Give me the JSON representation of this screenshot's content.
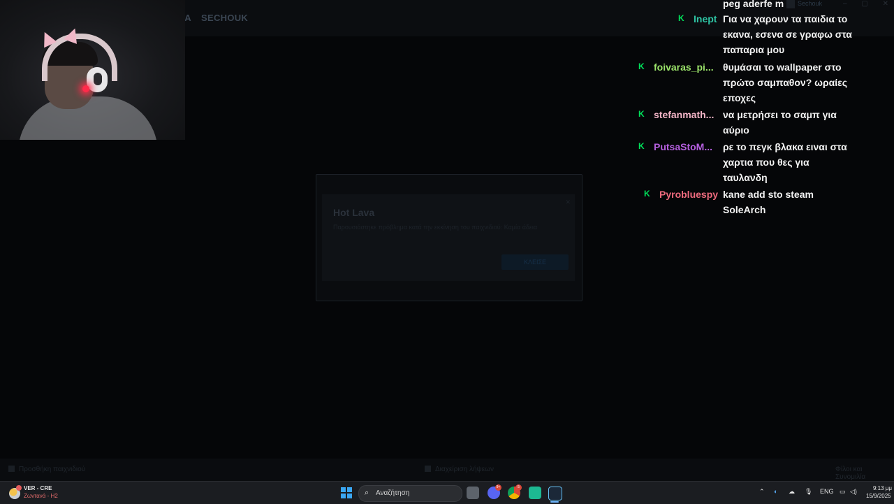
{
  "steam": {
    "nav_items": [
      "TA",
      "SECHOUK"
    ],
    "user_label": "Sechouk",
    "window_controls": [
      "–",
      "▢",
      "✕"
    ],
    "bottom_left": "Προσθήκη παιχνιδιού",
    "bottom_center": "Διαχείριση λήψεων",
    "bottom_right": "Φίλοι και Συνομιλία"
  },
  "dialog": {
    "title": "Hot Lava",
    "message": "Παρουσιάστηκε πρόβλημα κατά την εκκίνηση του παιχνιδιού: Καμία άδεια",
    "close_label": "✕",
    "button_label": "ΚΛΕΙΣΕ"
  },
  "chat": {
    "lines": [
      {
        "user": "",
        "user_color": "#ffffff",
        "message": "peg aderfe m",
        "badge": false
      },
      {
        "user": "Inept",
        "user_color": "#2ec4a4",
        "message": "Για να χαρουν τα παιδια το εκανα, εσενα σε γραφω στα παπαρια μου",
        "badge": true
      },
      {
        "user": "foivaras_pi...",
        "user_color": "#9be36a",
        "message": "θυμάσαι το wallpaper στο πρώτο σαμπαθον? ωραίες εποχες",
        "badge": true
      },
      {
        "user": "stefanmath...",
        "user_color": "#f4b6c8",
        "message": "να μετρήσει το σαμπ για αύριο",
        "badge": true
      },
      {
        "user": "PutsaStoM...",
        "user_color": "#b660e0",
        "message": "ρε το πεγκ βλακα ειναι στα χαρτια που θες για ταυλανδη",
        "badge": true
      },
      {
        "user": "Pyrobluespy",
        "user_color": "#ee6b7e",
        "message": "kane add sto steam SoleArch",
        "badge": true
      }
    ],
    "badge_glyph": "K",
    "badge_color": "#00e05a"
  },
  "taskbar": {
    "weather_title": "VER - CRE",
    "weather_subtitle": "Ζωντανά - H2",
    "search_placeholder": "Αναζήτηση",
    "discord_badge": "9+",
    "chrome_badge": "5",
    "language": "ENG",
    "time": "9:13 μμ",
    "date": "15/9/2025",
    "apps": [
      "file-explorer-icon",
      "discord-icon",
      "chrome-icon",
      "spotify-icon",
      "steam-icon"
    ]
  }
}
